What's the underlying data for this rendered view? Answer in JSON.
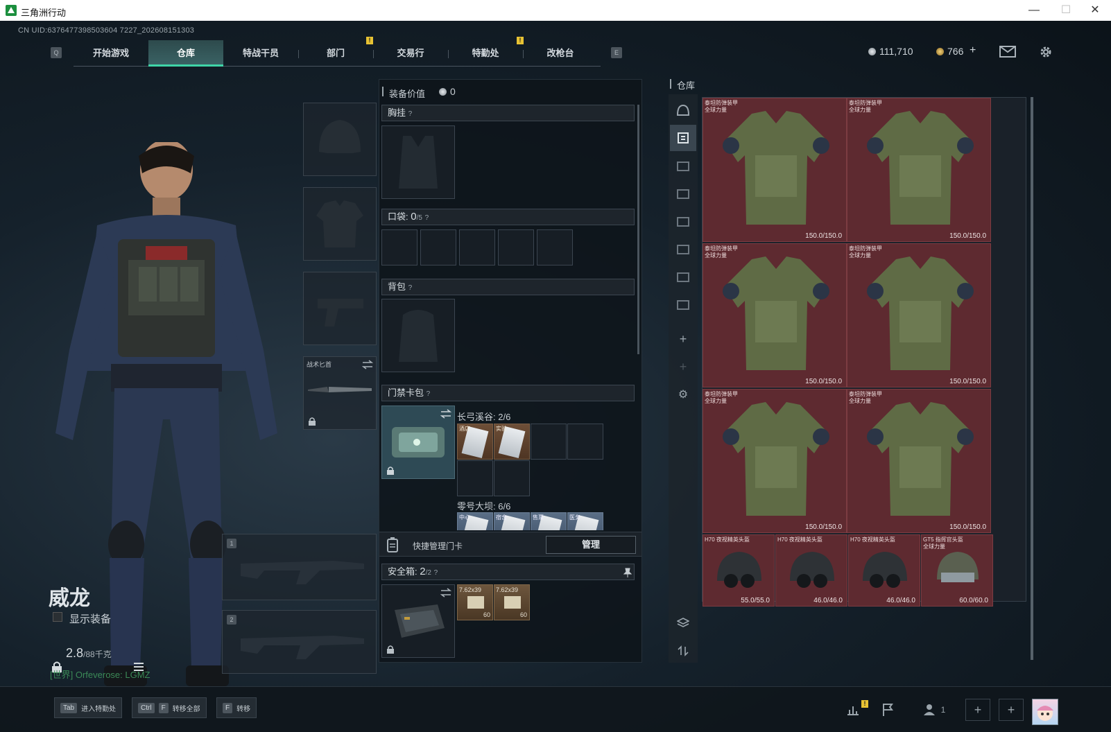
{
  "window": {
    "title": "三角洲行动",
    "minimize": "—",
    "maximize": "☐",
    "close": "✕"
  },
  "header": {
    "uid": "CN UID:6376477398503604 7227_202608151303",
    "nav": {
      "left_key": "Q",
      "right_key": "E",
      "tabs": [
        {
          "label": "开始游戏"
        },
        {
          "label": "仓库",
          "active": true
        },
        {
          "label": "特战干员"
        },
        {
          "label": "部门"
        },
        {
          "label": "交易行"
        },
        {
          "label": "特勤处"
        },
        {
          "label": "改枪台"
        }
      ],
      "notif_mark": "!"
    },
    "currency_silver": "111,710",
    "currency_gold": "766",
    "currency_add": "+"
  },
  "character": {
    "name": "威龙",
    "show_equipment": "显示装备",
    "weight_current": "2.8",
    "weight_max": "/88千克",
    "chat_channel": "[世界]",
    "chat_user": "Orfeverose: LGMZ",
    "slots": {
      "melee_label": "战术匕首",
      "primary_index": "1",
      "secondary_index": "2"
    }
  },
  "equipment": {
    "value_label": "装备价值",
    "value": "0",
    "chest_rig": "胸挂",
    "chest_help": "?",
    "pockets_label": "口袋:",
    "pockets_count": "0",
    "pockets_max": "/5",
    "pockets_help": "?",
    "backpack": "背包",
    "backpack_help": "?",
    "keycard_case": "门禁卡包",
    "keycard_help": "?",
    "map1": {
      "name": "长弓溪谷:",
      "count": "2/6",
      "cards": [
        {
          "label": "酒店"
        },
        {
          "label": "实验"
        }
      ]
    },
    "map2": {
      "name": "零号大坝:",
      "count": "6/6",
      "cards": [
        {
          "label": "中心"
        },
        {
          "label": "宿舍"
        },
        {
          "label": "售票"
        },
        {
          "label": "医务"
        }
      ]
    },
    "quick_manage": "快捷管理门卡",
    "manage_button": "管理",
    "safe_box": "安全箱:",
    "safe_count": "2",
    "safe_max": "/2",
    "safe_help": "?",
    "ammo": [
      {
        "label": "7.62x39",
        "qty": "60"
      },
      {
        "label": "7.62x39",
        "qty": "60"
      }
    ]
  },
  "warehouse": {
    "title": "仓库",
    "armor": [
      {
        "name": "泰坦防弹装甲",
        "sub": "全球力量",
        "durability": "150.0/150.0"
      },
      {
        "name": "泰坦防弹装甲",
        "sub": "全球力量",
        "durability": "150.0/150.0"
      },
      {
        "name": "泰坦防弹装甲",
        "sub": "全球力量",
        "durability": "150.0/150.0"
      },
      {
        "name": "泰坦防弹装甲",
        "sub": "全球力量",
        "durability": "150.0/150.0"
      },
      {
        "name": "泰坦防弹装甲",
        "sub": "全球力量",
        "durability": "150.0/150.0"
      },
      {
        "name": "泰坦防弹装甲",
        "sub": "全球力量",
        "durability": "150.0/150.0"
      }
    ],
    "helmets": [
      {
        "name": "H70 夜视精英头盔",
        "durability": "55.0/55.0"
      },
      {
        "name": "H70 夜视精英头盔",
        "durability": "46.0/46.0"
      },
      {
        "name": "H70 夜视精英头盔",
        "durability": "46.0/46.0"
      },
      {
        "name": "GT5 指挥官头盔",
        "sub": "全球力量",
        "durability": "60.0/60.0"
      }
    ],
    "sidebar": {
      "plus": "+",
      "settings": "⚙"
    }
  },
  "bottom": {
    "tab_key": "Tab",
    "tab_label": "进入特勤处",
    "ctrl_key": "Ctrl",
    "f_key": "F",
    "transfer_all": "转移全部",
    "f_key2": "F",
    "transfer": "转移",
    "friends_count": "1",
    "add": "+"
  },
  "colors": {
    "accent": "#3fd5a8",
    "armor_bg": "#5e2a30",
    "notif": "#e7c233"
  }
}
